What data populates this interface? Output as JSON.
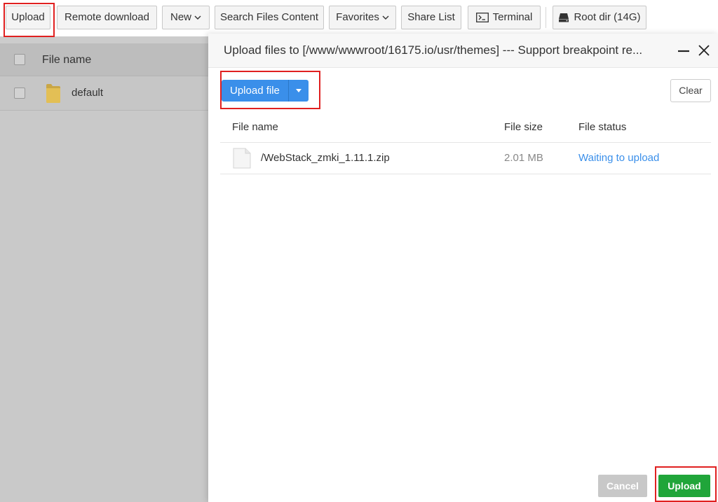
{
  "toolbar": {
    "upload_label": "Upload",
    "remote_download_label": "Remote download",
    "new_label": "New",
    "search_files_label": "Search Files Content",
    "favorites_label": "Favorites",
    "share_list_label": "Share List",
    "terminal_label": "Terminal",
    "root_dir_label": "Root dir (14G)"
  },
  "file_list": {
    "header": "File name",
    "items": [
      {
        "name": "default",
        "icon": "folder-icon"
      }
    ]
  },
  "dialog": {
    "title": "Upload files to [/www/wwwroot/16175.io/usr/themes] --- Support breakpoint re...",
    "upload_file_label": "Upload file",
    "clear_label": "Clear",
    "columns": {
      "name": "File name",
      "size": "File size",
      "status": "File status"
    },
    "files": [
      {
        "name": "/WebStack_zmki_1.11.1.zip",
        "size": "2.01 MB",
        "status": "Waiting to upload"
      }
    ],
    "cancel_label": "Cancel",
    "upload_label": "Upload"
  },
  "colors": {
    "primary_blue": "#3a8fea",
    "upload_green": "#20a53a",
    "highlight_red": "#e02020"
  }
}
